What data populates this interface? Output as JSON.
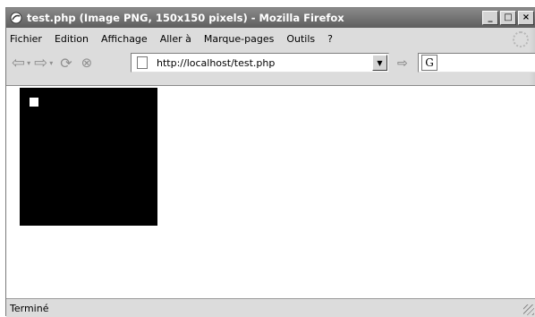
{
  "window": {
    "title": "test.php (Image PNG, 150x150 pixels) - Mozilla Firefox",
    "minimize": "_",
    "maximize": "□",
    "close": "×"
  },
  "menu": {
    "items": [
      "Fichier",
      "Edition",
      "Affichage",
      "Aller à",
      "Marque-pages",
      "Outils",
      "?"
    ]
  },
  "nav": {
    "back_icon": "⇦",
    "forward_icon": "⇨",
    "dropdown_arrow": "▾",
    "reload_icon": "⟳",
    "stop_icon": "⊗",
    "url": "http://localhost/test.php",
    "url_dropdown": "▼",
    "go_icon": "⇨",
    "search_engine": "G"
  },
  "content": {
    "image_width": 150,
    "image_height": 150
  },
  "status": {
    "text": "Terminé"
  }
}
